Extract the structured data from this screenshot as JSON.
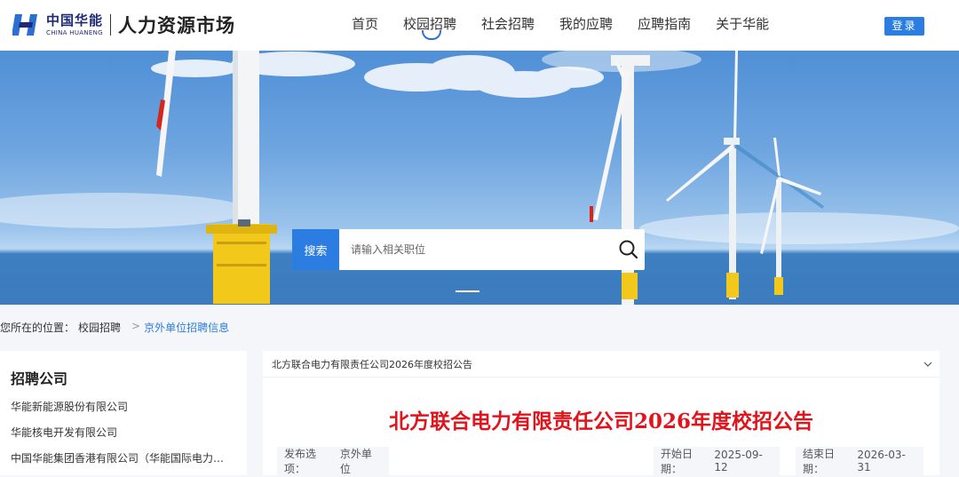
{
  "brand": {
    "name_cn": "中国华能",
    "name_en": "CHINA HUANENG",
    "site_title": "人力资源市场"
  },
  "nav": [
    {
      "label": "首页"
    },
    {
      "label": "校园招聘"
    },
    {
      "label": "社会招聘"
    },
    {
      "label": "我的应聘"
    },
    {
      "label": "应聘指南"
    },
    {
      "label": "关于华能"
    }
  ],
  "login_label": "登录",
  "search": {
    "button": "搜索",
    "placeholder": "请输入相关职位"
  },
  "breadcrumb": {
    "prefix": "您所在的位置：",
    "level1": "校园招聘",
    "sep": ">",
    "current": "京外单位招聘信息"
  },
  "sidebar": {
    "title": "招聘公司",
    "companies": [
      "华能新能源股份有限公司",
      "华能核电开发有限公司",
      "中国华能集团香港有限公司（华能国际电力…"
    ]
  },
  "post": {
    "header": "北方联合电力有限责任公司2026年度校招公告",
    "title": "北方联合电力有限责任公司2026年度校招公告",
    "publish_label": "发布选项：",
    "publish_value": "京外单位",
    "start_label": "开始日期：",
    "start_value": "2025-09-12",
    "end_label": "结束日期：",
    "end_value": "2026-03-31"
  },
  "colors": {
    "accent": "#2b7de1",
    "title_red": "#e3131b",
    "brand_navy": "#1e2a78"
  }
}
